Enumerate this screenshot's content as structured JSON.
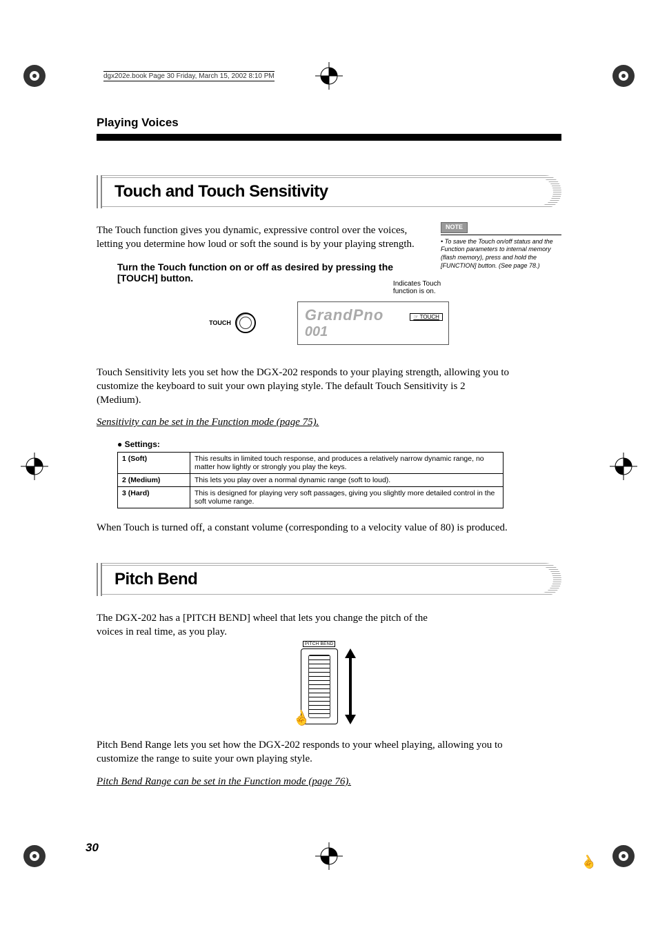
{
  "header_info": "dgx202e.book  Page 30  Friday, March 15, 2002  8:10 PM",
  "section_name": "Playing Voices",
  "touch": {
    "title": "Touch and Touch Sensitivity",
    "intro": "The Touch function gives you dynamic, expressive control over the voices, letting you determine how loud or soft the sound is by your playing strength.",
    "instruction": "Turn the Touch function on or off as desired by pressing the [TOUCH] button.",
    "note_label": "NOTE",
    "note_text": "To save the Touch on/off status and the Function parameters to internal memory (flash memory), press and hold the [FUNCTION] button. (See page 78.)",
    "button_label": "TOUCH",
    "display_main": "GrandPno",
    "display_sub": "001",
    "touch_indicator": "TOUCH",
    "indicator_caption": "Indicates Touch function is on.",
    "sensitivity_text": "Touch Sensitivity lets you set how the DGX-202 responds to your playing strength, allowing you to customize the keyboard to suit your own playing style. The default Touch Sensitivity is 2 (Medium).",
    "link": "Sensitivity can be set in the Function mode (page 75).",
    "settings_heading": "Settings:",
    "settings": [
      {
        "name": "1 (Soft)",
        "desc": "This results in limited touch response, and produces a relatively narrow dynamic range, no matter how lightly or strongly you play the keys."
      },
      {
        "name": "2 (Medium)",
        "desc": "This lets you play over a normal dynamic range (soft to loud)."
      },
      {
        "name": "3 (Hard)",
        "desc": "This is designed for playing very soft passages, giving you slightly more detailed control in the soft volume range."
      }
    ],
    "off_text": "When Touch is turned off, a constant volume (corresponding to a velocity value of 80) is produced."
  },
  "pitch": {
    "title": "Pitch Bend",
    "intro": "The DGX-202 has a [PITCH BEND] wheel that lets you change the pitch of the voices in real time, as you play.",
    "wheel_label": "PITCH BEND",
    "range_text": "Pitch Bend Range lets you set how the DGX-202 responds to your wheel playing, allowing you to customize the range to suite your own playing style.",
    "link": "Pitch Bend Range can be set in the Function mode (page 76)."
  },
  "page_number": "30"
}
